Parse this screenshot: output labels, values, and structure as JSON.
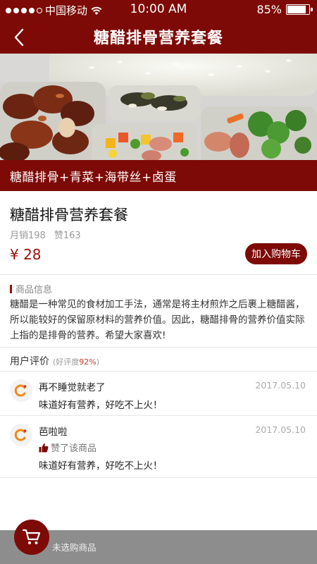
{
  "status_bar": {
    "carrier": "中国移动",
    "time": "10:00 AM",
    "battery": "85%",
    "battery_level": 0.85
  },
  "header": {
    "title": "糖醋排骨营养套餐"
  },
  "hero": {
    "banner_text": "糖醋排骨+青菜+海带丝+卤蛋"
  },
  "product": {
    "name": "糖醋排骨营养套餐",
    "monthly_sales": "月销198",
    "likes": "赞163",
    "price": "¥ 28",
    "add_to_cart_label": "加入购物车"
  },
  "info": {
    "section_title": "商品信息",
    "description": "糖醋是一种常见的食材加工手法，通常是将主材煎炸之后裹上糖醋酱，所以能较好的保留原材料的营养价值。因此，糖醋排骨的营养价值实际上指的是排骨的营养。希望大家喜欢!"
  },
  "reviews": {
    "title": "用户评价",
    "rating_prefix": "(好评度",
    "rating_value": "92%",
    "rating_suffix": ")",
    "items": [
      {
        "user": "再不睡觉就老了",
        "date": "2017.05.10",
        "text": "味道好有营养，好吃不上火！"
      },
      {
        "user": "芭啦啦",
        "date": "2017.05.10",
        "liked": "赞了该商品",
        "text": "味道好有营养，好吃不上火！"
      }
    ]
  },
  "cart": {
    "status_label": "未选购商品"
  },
  "colors": {
    "brand": "#7d0a06",
    "accent": "#9b0d0a",
    "cart_bar": "#8d8d8d"
  },
  "icons": [
    "back-icon",
    "wifi-icon",
    "battery-icon",
    "thumb-up-icon",
    "cart-icon",
    "avatar-icon"
  ]
}
